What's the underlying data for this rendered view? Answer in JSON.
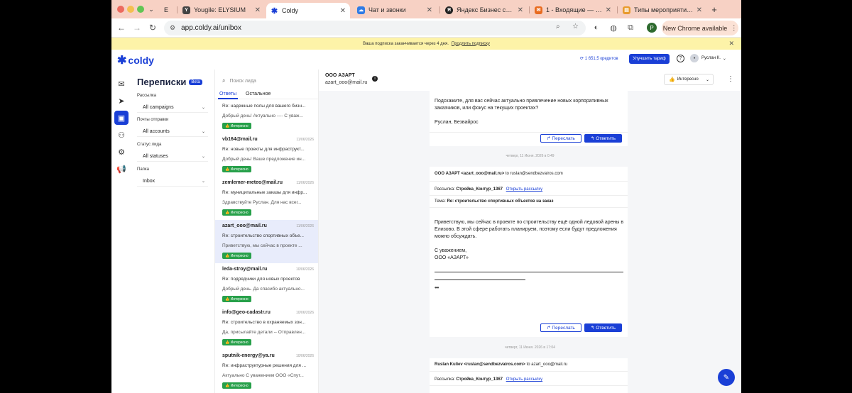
{
  "browser": {
    "tabs": [
      {
        "title": "E",
        "icon": "page-icon"
      },
      {
        "title": "Yougile: ELYSIUM",
        "icon": "yougile-icon"
      },
      {
        "title": "Coldy",
        "icon": "coldy-icon"
      },
      {
        "title": "Чат и звонки",
        "icon": "bitrix-icon"
      },
      {
        "title": "Яндекс Бизнес сам за...",
        "icon": "yandex-icon"
      },
      {
        "title": "1 - Входящие — Ящик...",
        "icon": "mail-icon"
      },
      {
        "title": "Типы мероприятий | ...",
        "icon": "doc-icon"
      }
    ],
    "url": "app.coldy.ai/unibox",
    "profile_initial": "P",
    "new_chrome": "New Chrome available",
    "colors": {
      "tabstrip": "#f7d1c4",
      "accent": "#1a3fd6",
      "badge_green": "#27a04a"
    }
  },
  "banner": {
    "text": "Ваша подписка заканчивается через 4 дня.",
    "link": "Продлить подписку"
  },
  "app": {
    "logo": "coldy",
    "credits": "1 651,5 кредитов",
    "upgrade": "Улучшить тариф",
    "help": "?",
    "user": "Руслан К."
  },
  "sidebar_icons": [
    "mail-icon",
    "send-icon",
    "inbox-icon",
    "users-icon",
    "settings-icon",
    "megaphone-icon"
  ],
  "filters": {
    "title": "Переписки",
    "beta": "Beta",
    "groups": [
      {
        "label": "Рассылка",
        "value": "All campaigns"
      },
      {
        "label": "Почты отправки",
        "value": "All accounts"
      },
      {
        "label": "Статус лида",
        "value": "All statuses"
      },
      {
        "label": "Папка",
        "value": "Inbox"
      }
    ]
  },
  "conversations": {
    "search_placeholder": "Поиск лида",
    "tabs": [
      "Ответы",
      "Остальное"
    ],
    "items": [
      {
        "email": "",
        "date": "",
        "subject": "Re: надежные полы для вашего бизн...",
        "preview": "Добрый день! Актуально  ---- С уваж...",
        "badge": "Интересно"
      },
      {
        "email": "vb164@mail.ru",
        "date": "11/06/2026",
        "subject": "Re: новые проекты для инфраструкт...",
        "preview": "Добрый день! Ваше предложение ин...",
        "badge": "Интересно"
      },
      {
        "email": "zemlemer-meteo@mail.ru",
        "date": "11/06/2026",
        "subject": "Re: муниципальные заказы для инфр...",
        "preview": "Здравствуйте Руслан. Для нас всег...",
        "badge": "Интересно"
      },
      {
        "email": "azart_ooo@mail.ru",
        "date": "11/06/2026",
        "subject": "Re: строительство спортивных объе...",
        "preview": "Приветствую, мы сейчас в проекте ...",
        "badge": "Интересно"
      },
      {
        "email": "leda-stroy@mail.ru",
        "date": "10/06/2026",
        "subject": "Re: подрядчики для новых проектов",
        "preview": "Добрый день. Да спасибо актуально...",
        "badge": "Интересно"
      },
      {
        "email": "info@geo-cadastr.ru",
        "date": "10/06/2026",
        "subject": "Re: строительство в охраняемых зон...",
        "preview": "Да, присылайте детали -- Отправлен...",
        "badge": "Интересно"
      },
      {
        "email": "sputnik-energy@ya.ru",
        "date": "10/06/2026",
        "subject": "Re: инфраструктурные решения для ...",
        "preview": "Актуально  С уважением ООО «Спут...",
        "badge": "Интересно"
      }
    ]
  },
  "thread": {
    "name": "ООО АЗАРТ",
    "email": "azart_ooo@mail.ru",
    "status": "Интересно",
    "first_body": [
      "Подскажите, для вас сейчас актуально привлечение новых корпоративных",
      "заказчиков, или фокус на текущих проектах?",
      "",
      "Руслан, Безвайрос"
    ],
    "forward": "Переслать",
    "reply": "Ответить",
    "sep1": "четверг, 11 Июня. 2026 в 0:49",
    "msg2": {
      "from": "ООО АЗАРТ <azart_ooo@mail.ru>",
      "to": "to ruslan@sendbezvairos.com",
      "campaign_label": "Рассылка:",
      "campaign": "Стройка_Контур_1367",
      "open_link": "Открыть рассылку",
      "subject_label": "Тема:",
      "subject": "Re: строительство спортивных объектов на заказ",
      "body": [
        "Приветствую, мы сейчас в проекте по строительству ещё одной ледовой арены в",
        "Елизово. В этой сфере работать планируем, поэтому  если будут предложения",
        "можно обсуждать.",
        "",
        "С уважением,",
        "ООО «АЗАРТ»"
      ],
      "ellipsis": "•••"
    },
    "sep2": "четверг, 11 Июня. 2026 в 17:04",
    "msg3": {
      "from": "Ruslan Kuliev <ruslan@sendbezvairos.com>",
      "to": "to azart_ooo@mail.ru",
      "campaign_label": "Рассылка:",
      "campaign": "Стройка_Контур_1367",
      "open_link": "Открыть рассылку"
    }
  }
}
